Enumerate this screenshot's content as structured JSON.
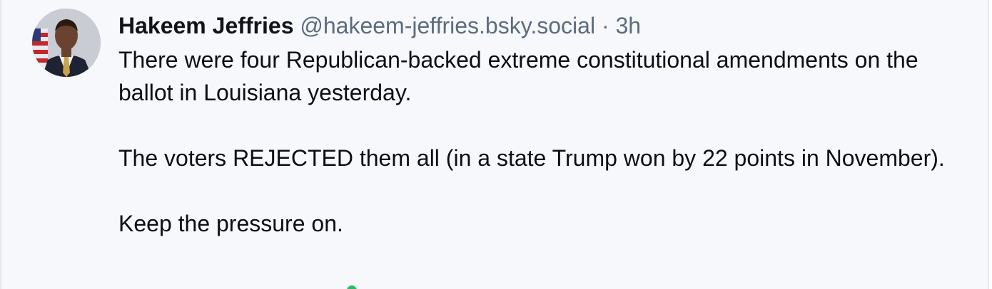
{
  "post": {
    "author_name": "Hakeem Jeffries",
    "handle": "@hakeem-jeffries.bsky.social",
    "separator": "·",
    "time": "3h",
    "paragraphs": [
      "There were four Republican-backed extreme constitutional amendments on the ballot in Louisiana yesterday.",
      "The voters REJECTED them all (in a state Trump won by 22 points in November).",
      "Keep the pressure on."
    ]
  },
  "avatar": {
    "icon": "profile-photo",
    "colors": {
      "background": "#c9ccd3",
      "suit": "#1d2333",
      "shirt": "#f2f2f2",
      "tie": "#c9a24a",
      "skin": "#6a4330",
      "flag_red": "#c0282d",
      "flag_blue": "#2a3b78"
    }
  },
  "colors": {
    "card_bg": "#f7f8fb",
    "name": "#101418",
    "meta": "#5d6b7e",
    "text": "#0b0f14"
  }
}
